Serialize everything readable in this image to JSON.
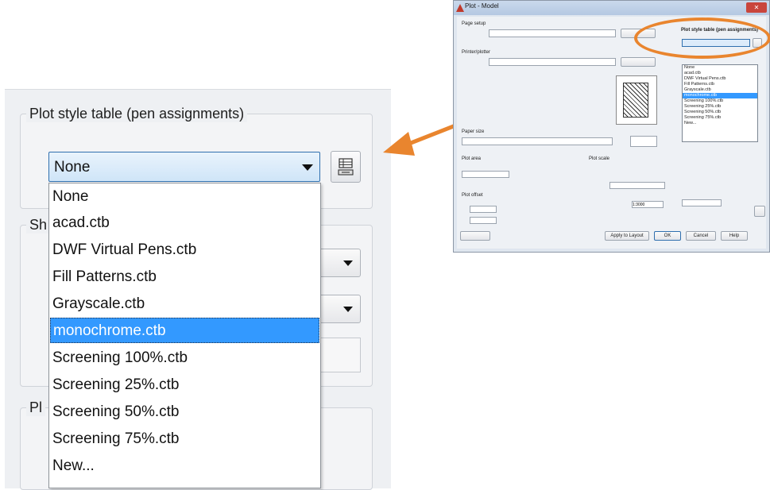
{
  "zoom": {
    "group_title": "Plot style table (pen assignments)",
    "selected_value": "None",
    "partial_label_1": "Sh",
    "partial_label_2": "Pl",
    "options": [
      "None",
      "acad.ctb",
      "DWF Virtual Pens.ctb",
      "Fill Patterns.ctb",
      "Grayscale.ctb",
      "monochrome.ctb",
      "Screening 100%.ctb",
      "Screening 25%.ctb",
      "Screening 50%.ctb",
      "Screening 75%.ctb",
      "New..."
    ],
    "highlighted_option": "monochrome.ctb"
  },
  "colors": {
    "highlight": "#3399ff",
    "callout_arrow": "#e9852e",
    "panel_bg": "#eef0f3"
  },
  "thumbnail": {
    "title": "Plot - Model",
    "close_glyph": "✕",
    "section_plot_style_table": "Plot style table (pen assignments)",
    "list_items": [
      "None",
      "acad.ctb",
      "DWF Virtual Pens.ctb",
      "Fill Patterns.ctb",
      "Grayscale.ctb",
      "monochrome.ctb",
      "Screening 100%.ctb",
      "Screening 25%.ctb",
      "Screening 50%.ctb",
      "Screening 75%.ctb",
      "New..."
    ],
    "selected_list_item": "monochrome.ctb",
    "scale_value": "1:3000",
    "buttons": {
      "apply": "Apply to Layout",
      "ok": "OK",
      "cancel": "Cancel",
      "help": "Help"
    }
  }
}
